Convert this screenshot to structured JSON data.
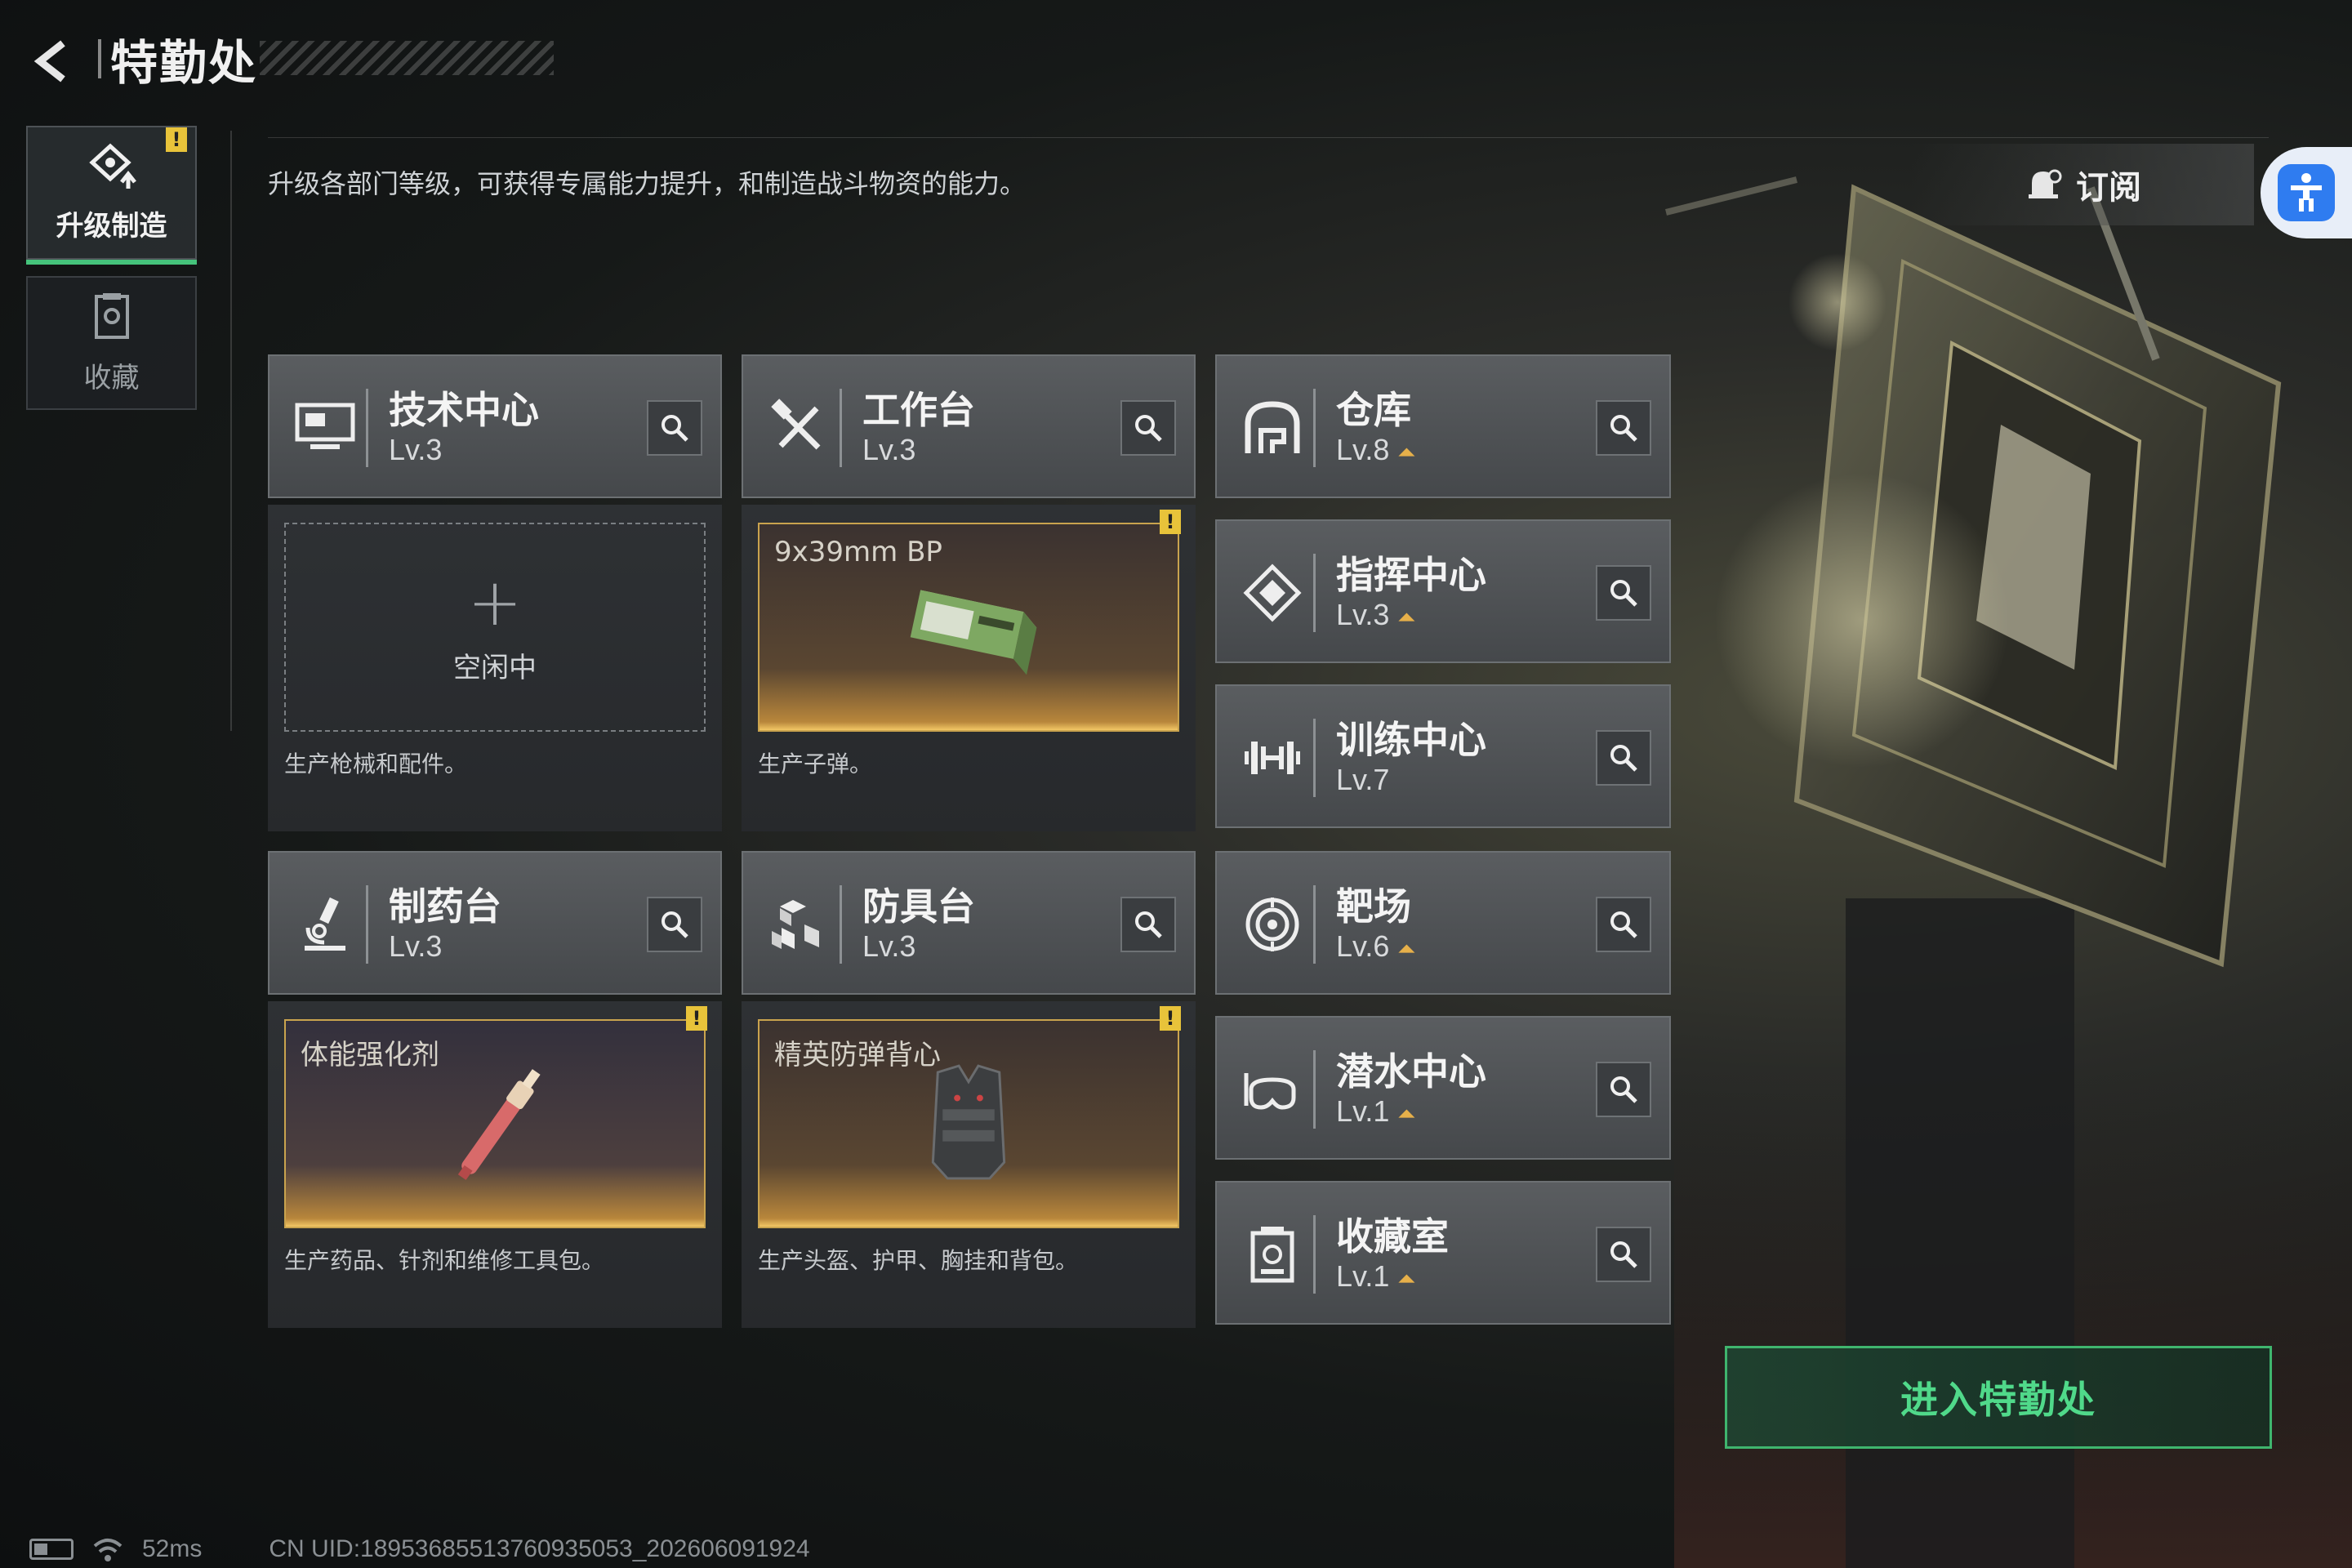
{
  "header": {
    "title": "特勤处",
    "back_icon": "back-arrow-icon"
  },
  "nav": [
    {
      "label": "升级制造",
      "icon": "upgrade-icon",
      "active": true,
      "alert": "!"
    },
    {
      "label": "收藏",
      "icon": "collection-icon",
      "active": false
    }
  ],
  "description": "升级各部门等级，可获得专属能力提升，和制造战斗物资的能力。",
  "subscribe": {
    "label": "订阅",
    "icon": "bell-icon"
  },
  "accessibility": {
    "icon": "accessibility-icon"
  },
  "departments": {
    "tech_center": {
      "name": "技术中心",
      "level": "Lv.3"
    },
    "workbench": {
      "name": "工作台",
      "level": "Lv.3"
    },
    "warehouse": {
      "name": "仓库",
      "level": "Lv.8"
    },
    "command_center": {
      "name": "指挥中心",
      "level": "Lv.3"
    },
    "training_center": {
      "name": "训练中心",
      "level": "Lv.7"
    },
    "pharmacy": {
      "name": "制药台",
      "level": "Lv.3"
    },
    "armor_bench": {
      "name": "防具台",
      "level": "Lv.3"
    },
    "shooting_range": {
      "name": "靶场",
      "level": "Lv.6"
    },
    "diving_center": {
      "name": "潜水中心",
      "level": "Lv.1"
    },
    "collection_room": {
      "name": "收藏室",
      "level": "Lv.1"
    }
  },
  "productions": {
    "tech_center": {
      "status": "空闲中",
      "description": "生产枪械和配件。"
    },
    "workbench": {
      "item": "9x39mm BP",
      "description": "生产子弹。",
      "alert": "!"
    },
    "pharmacy": {
      "item": "体能强化剂",
      "description": "生产药品、针剂和维修工具包。",
      "alert": "!"
    },
    "armor_bench": {
      "item": "精英防弹背心",
      "description": "生产头盔、护甲、胸挂和背包。",
      "alert": "!"
    }
  },
  "enter_button": {
    "label": "进入特勤处"
  },
  "status_bar": {
    "ping": "52ms",
    "uid": "CN UID:18953685513760935053_202606091924"
  },
  "colors": {
    "accent_green": "#45c37b",
    "warning_yellow": "#e8c33a",
    "upgrade_gold": "#e6b04a"
  }
}
